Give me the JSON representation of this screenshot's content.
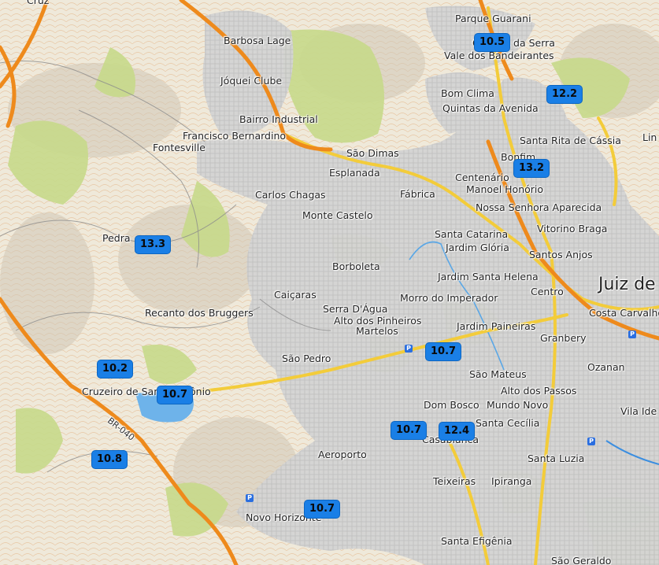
{
  "places": [
    {
      "key": "parque_guarani",
      "text": "Parque Guarani"
    },
    {
      "key": "barbosa_lage",
      "text": "Barbosa Lage"
    },
    {
      "key": "granjas_da_serra",
      "text": "Granjas da Serra"
    },
    {
      "key": "vale_bandeirantes",
      "text": "Vale dos Bandeirantes"
    },
    {
      "key": "joquei_clube",
      "text": "Jóquei Clube"
    },
    {
      "key": "bom_clima",
      "text": "Bom Clima"
    },
    {
      "key": "quintas_avenida",
      "text": "Quintas da Avenida"
    },
    {
      "key": "bairro_industrial",
      "text": "Bairro Industrial"
    },
    {
      "key": "francisco_bernardino",
      "text": "Francisco Bernardino"
    },
    {
      "key": "santa_rita",
      "text": "Santa Rita de Cássia"
    },
    {
      "key": "fontesville",
      "text": "Fontesville"
    },
    {
      "key": "sao_dimas",
      "text": "São Dimas"
    },
    {
      "key": "bonfim",
      "text": "Bonfim"
    },
    {
      "key": "esplanada",
      "text": "Esplanada"
    },
    {
      "key": "centenario",
      "text": "Centenário"
    },
    {
      "key": "fabrica",
      "text": "Fábrica"
    },
    {
      "key": "manoel_honorio",
      "text": "Manoel Honório"
    },
    {
      "key": "carlos_chagas",
      "text": "Carlos Chagas"
    },
    {
      "key": "nossa_senhora",
      "text": "Nossa Senhora Aparecida"
    },
    {
      "key": "monte_castelo",
      "text": "Monte Castelo"
    },
    {
      "key": "santa_catarina",
      "text": "Santa Catarina"
    },
    {
      "key": "vitorino_braga",
      "text": "Vitorino Braga"
    },
    {
      "key": "pedra",
      "text": "Pedra"
    },
    {
      "key": "jardim_gloria",
      "text": "Jardim Glória"
    },
    {
      "key": "santos_anjos",
      "text": "Santos Anjos"
    },
    {
      "key": "borboleta",
      "text": "Borboleta"
    },
    {
      "key": "juiz_de_fora",
      "text": "Juiz de"
    },
    {
      "key": "jardim_santa_helena",
      "text": "Jardim Santa Helena"
    },
    {
      "key": "caicaras",
      "text": "Caiçaras"
    },
    {
      "key": "morro_imperador",
      "text": "Morro do Imperador"
    },
    {
      "key": "centro",
      "text": "Centro"
    },
    {
      "key": "serra_dagua",
      "text": "Serra D'Água"
    },
    {
      "key": "recanto_bruggers",
      "text": "Recanto dos Bruggers"
    },
    {
      "key": "costa_carvalho",
      "text": "Costa Carvalho"
    },
    {
      "key": "alto_pinheiros",
      "text": "Alto dos Pinheiros"
    },
    {
      "key": "jardim_paineiras",
      "text": "Jardim Paineiras"
    },
    {
      "key": "martelos",
      "text": "Martelos"
    },
    {
      "key": "granbery",
      "text": "Granbery"
    },
    {
      "key": "sao_pedro",
      "text": "São Pedro"
    },
    {
      "key": "ozanan",
      "text": "Ozanan"
    },
    {
      "key": "sao_mateus",
      "text": "São Mateus"
    },
    {
      "key": "alto_passos",
      "text": "Alto dos Passos"
    },
    {
      "key": "cruzeiro",
      "text": "Cruzeiro de Santo Antônio"
    },
    {
      "key": "dom_bosco",
      "text": "Dom Bosco"
    },
    {
      "key": "mundo_novo",
      "text": "Mundo Novo"
    },
    {
      "key": "vila_ide",
      "text": "Vila Ide"
    },
    {
      "key": "br040",
      "text": "BR-040"
    },
    {
      "key": "santa_cecilia",
      "text": "Santa Cecília"
    },
    {
      "key": "casablanca",
      "text": "Casablanca"
    },
    {
      "key": "santa_luzia",
      "text": "Santa Luzia"
    },
    {
      "key": "aeroporto",
      "text": "Aeroporto"
    },
    {
      "key": "teixeiras",
      "text": "Teixeiras"
    },
    {
      "key": "ipiranga",
      "text": "Ipiranga"
    },
    {
      "key": "novo_horizonte",
      "text": "Novo Horizonte"
    },
    {
      "key": "santa_efigenia",
      "text": "Santa Efigênia"
    },
    {
      "key": "sao_geraldo",
      "text": "São Geraldo"
    },
    {
      "key": "linhares",
      "text": "Lin"
    },
    {
      "key": "cruz",
      "text": "Cruz"
    }
  ],
  "markers": [
    {
      "key": "m1",
      "value": "10.5"
    },
    {
      "key": "m2",
      "value": "12.2"
    },
    {
      "key": "m3",
      "value": "13.2"
    },
    {
      "key": "m4",
      "value": "13.3"
    },
    {
      "key": "m5",
      "value": "10.7"
    },
    {
      "key": "m6",
      "value": "10.2"
    },
    {
      "key": "m7",
      "value": "10.7"
    },
    {
      "key": "m8",
      "value": "10.7"
    },
    {
      "key": "m9",
      "value": "12.4"
    },
    {
      "key": "m10",
      "value": "10.8"
    },
    {
      "key": "m11",
      "value": "10.7"
    }
  ],
  "colors": {
    "land": "#f2eee3",
    "forest": "#c9da8e",
    "urban": "#d8d8d8",
    "highway": "#f08c1e",
    "primary": "#f6d24a",
    "water": "#5aa7e6",
    "contour": "#e3b48a",
    "marker": "#1a7fe6"
  }
}
